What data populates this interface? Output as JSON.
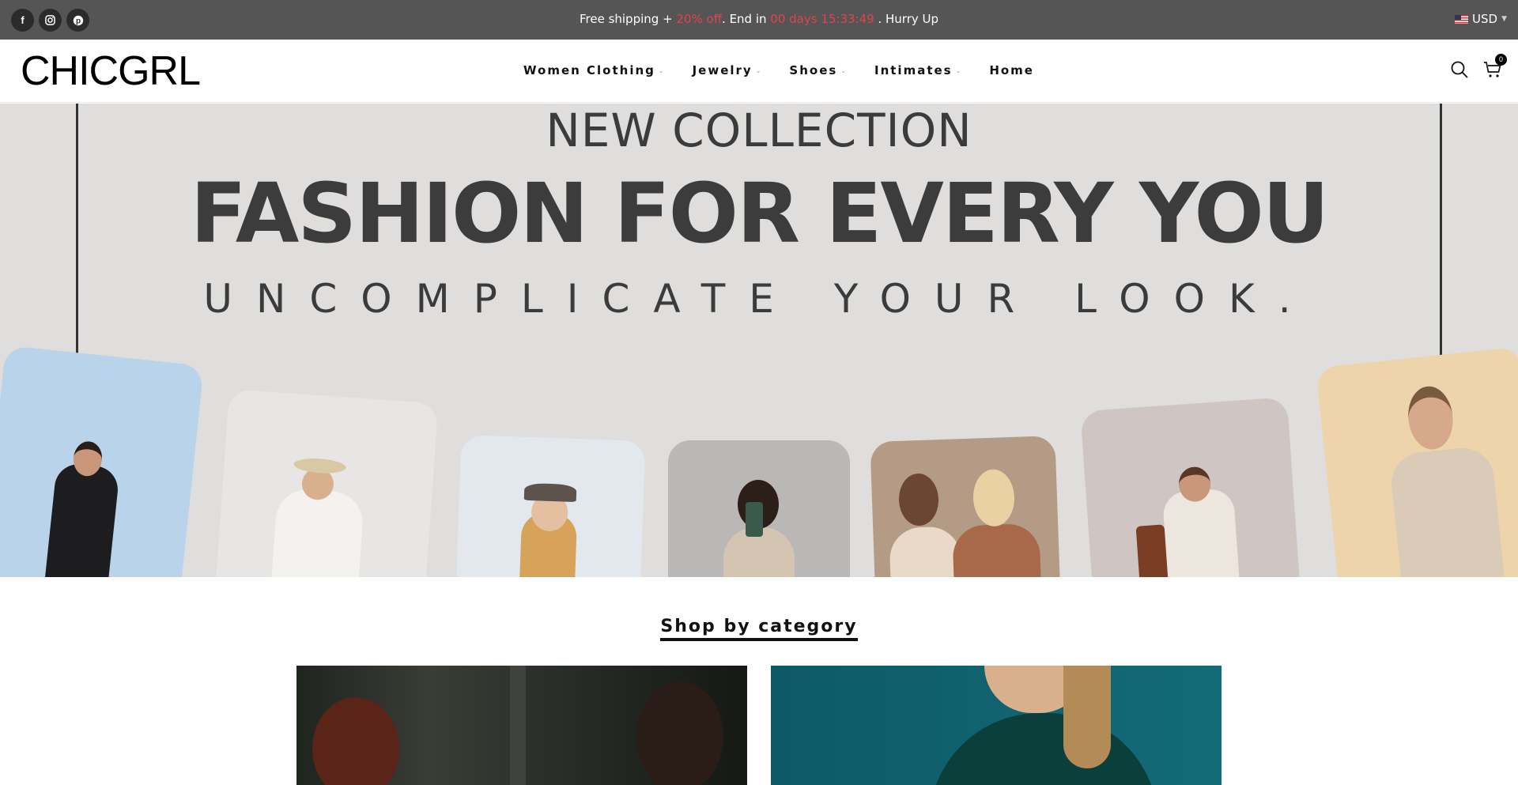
{
  "topbar": {
    "social_icons": [
      "facebook-icon",
      "instagram-icon",
      "pinterest-icon"
    ],
    "announce_prefix": "Free shipping + ",
    "announce_discount": "20% off",
    "announce_mid": ". End in ",
    "announce_countdown": "00 days 15:33:49",
    "announce_suffix": " . Hurry Up",
    "currency": "USD"
  },
  "header": {
    "logo": "CHICGRL",
    "nav": [
      {
        "label": "Women Clothing",
        "has_dropdown": true
      },
      {
        "label": "Jewelry",
        "has_dropdown": true
      },
      {
        "label": "Shoes",
        "has_dropdown": true
      },
      {
        "label": "Intimates",
        "has_dropdown": true
      },
      {
        "label": "Home",
        "has_dropdown": false
      }
    ],
    "cart_count": "0"
  },
  "hero": {
    "line1": "NEW COLLECTION",
    "line2": "FASHION FOR EVERY YOU",
    "line3": "UNCOMPLICATE YOUR LOOK."
  },
  "categories": {
    "title": "Shop by category"
  },
  "colors": {
    "topbar_bg": "#555555",
    "accent_red": "#e0444a",
    "hero_bg": "#dfdedd",
    "text_dark": "#3c3c3c"
  }
}
